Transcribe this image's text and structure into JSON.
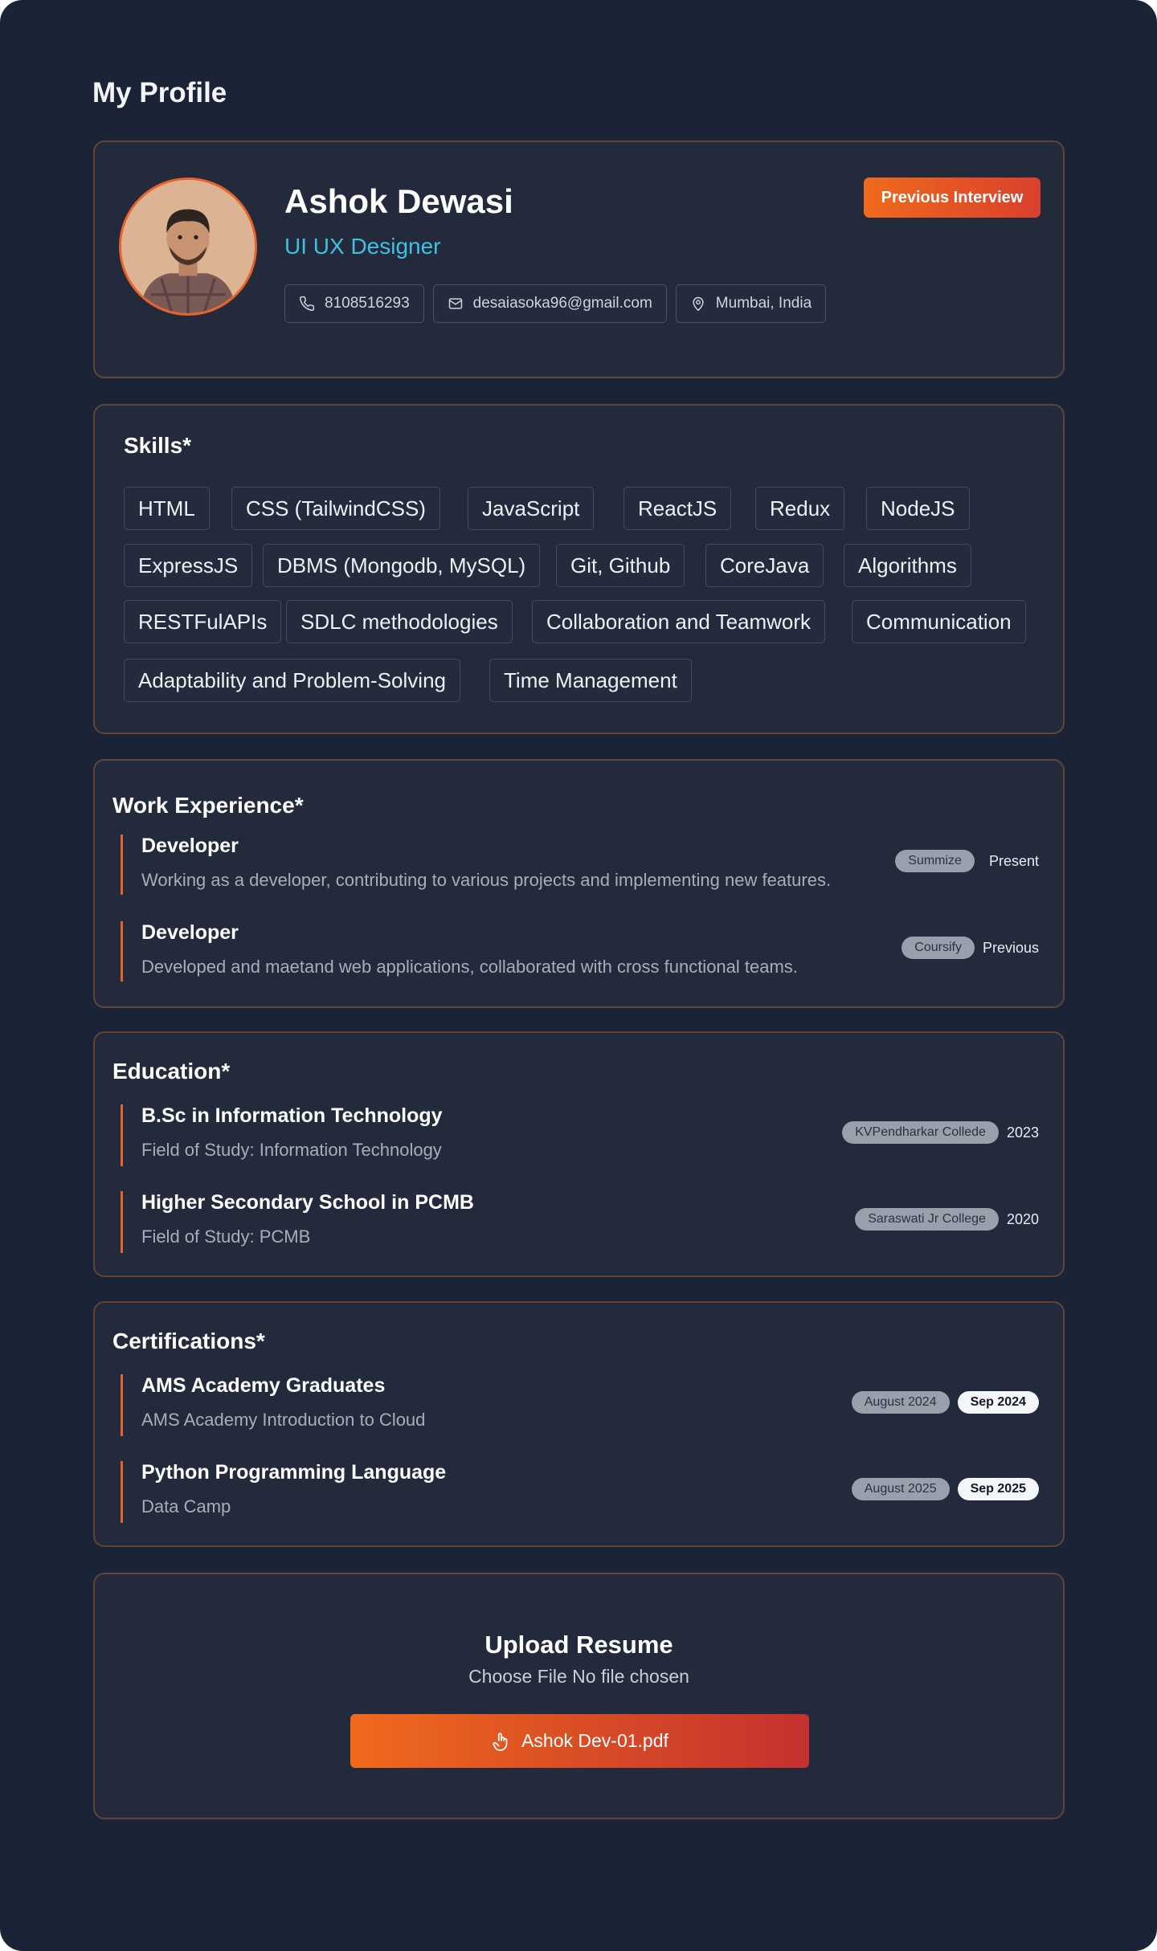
{
  "page": {
    "title": "My Profile"
  },
  "profile": {
    "name": "Ashok Dewasi",
    "role": "UI UX Designer",
    "previous_interview_label": "Previous Interview",
    "phone": "8108516293",
    "email": "desaiasoka96@gmail.com",
    "location": "Mumbai, India"
  },
  "skills": {
    "title": "Skills*",
    "items": [
      "HTML",
      "CSS (TailwindCSS)",
      "JavaScript",
      "ReactJS",
      "Redux",
      "NodeJS",
      "ExpressJS",
      "DBMS (Mongodb, MySQL)",
      "Git, Github",
      "CoreJava",
      "Algorithms",
      "RESTFulAPIs",
      "SDLC methodologies",
      "Collaboration and Teamwork",
      "Communication",
      "Adaptability and Problem-Solving",
      "Time Management"
    ]
  },
  "work": {
    "title": "Work Experience*",
    "items": [
      {
        "role": "Developer",
        "description": "Working as a developer, contributing to various projects and implementing new features.",
        "company": "Summize",
        "status": "Present"
      },
      {
        "role": "Developer",
        "description": "Developed and maetand web applications, collaborated with cross functional teams.",
        "company": "Coursify",
        "status": "Previous"
      }
    ]
  },
  "education": {
    "title": "Education*",
    "items": [
      {
        "degree": "B.Sc in Information Technology",
        "field": "Field of Study: Information Technology",
        "institution": "KVPendharkar Collede",
        "year": "2023"
      },
      {
        "degree": "Higher Secondary School in PCMB",
        "field": "Field of Study: PCMB",
        "institution": "Saraswati Jr College",
        "year": "2020"
      }
    ]
  },
  "certifications": {
    "title": "Certifications*",
    "items": [
      {
        "name": "AMS Academy Graduates",
        "provider": "AMS Academy Introduction to Cloud",
        "start": "August 2024",
        "end": "Sep 2024"
      },
      {
        "name": "Python Programming Language",
        "provider": "Data Camp",
        "start": "August 2025",
        "end": "Sep 2025"
      }
    ]
  },
  "upload": {
    "title": "Upload Resume",
    "file_status": "Choose File No file chosen",
    "file_name": "Ashok Dev-01.pdf"
  },
  "colors": {
    "background": "#1b2437",
    "card": "#222a3b",
    "accent": "#e8622b",
    "role_text": "#3fc0e4"
  }
}
